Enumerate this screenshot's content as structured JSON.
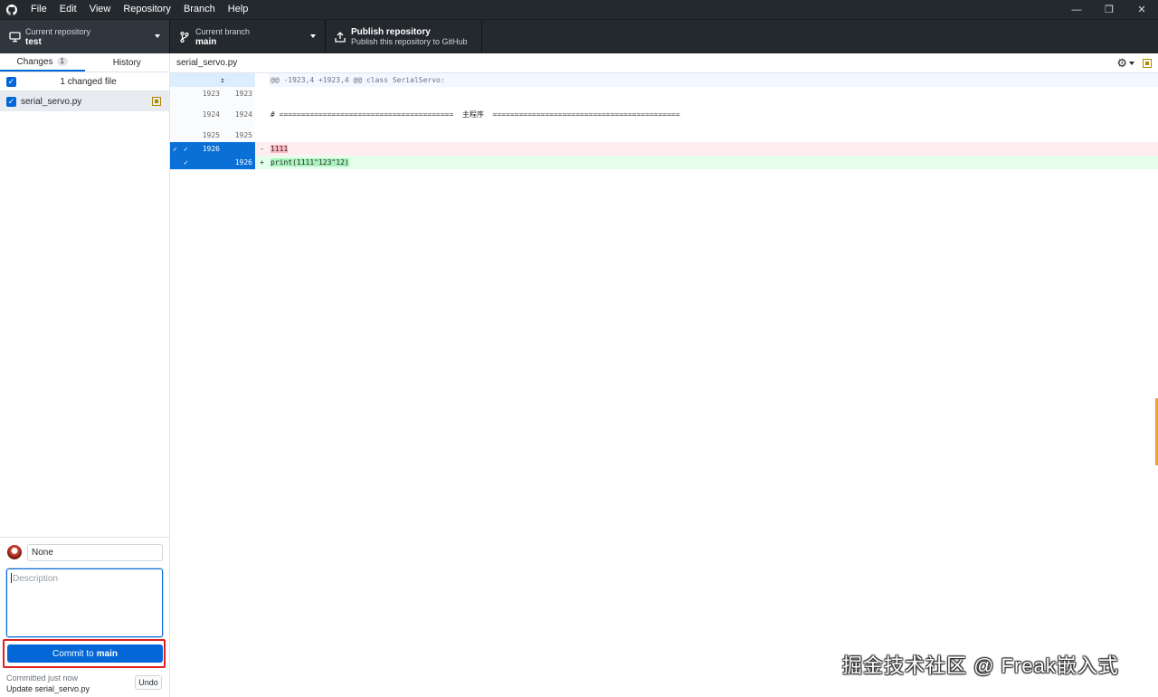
{
  "menu": [
    "File",
    "Edit",
    "View",
    "Repository",
    "Branch",
    "Help"
  ],
  "toolbar": {
    "repo": {
      "desc": "Current repository",
      "title": "test"
    },
    "branch": {
      "desc": "Current branch",
      "title": "main"
    },
    "publish": {
      "desc": "Publish this repository to GitHub",
      "title": "Publish repository"
    }
  },
  "sidebar": {
    "tabs": [
      {
        "label": "Changes",
        "count": "1"
      },
      {
        "label": "History"
      }
    ],
    "changed_files_label": "1 changed file",
    "files": [
      {
        "name": "serial_servo.py"
      }
    ]
  },
  "commit": {
    "summary_value": "None",
    "description_placeholder": "Description",
    "button_prefix": "Commit to",
    "button_branch": "main",
    "last_commit_time": "Committed just now",
    "last_commit_msg": "Update serial_servo.py",
    "undo_label": "Undo"
  },
  "diff": {
    "filename": "serial_servo.py",
    "hunk_header": "@@ -1923,4 +1923,4 @@ class SerialServo:",
    "lines": [
      {
        "old": "1923",
        "new": "1923",
        "code": ""
      },
      {
        "old": "1924",
        "new": "1924",
        "code": "# ========================================  主程序  ==========================================="
      },
      {
        "old": "1925",
        "new": "1925",
        "code": ""
      },
      {
        "old": "1926",
        "new": "",
        "mark": "-",
        "code": "1111"
      },
      {
        "old": "",
        "new": "1926",
        "mark": "+",
        "code": "print(1111\"123\"12)"
      }
    ]
  },
  "watermark": "掘金技术社区 @ Freak嵌入式",
  "colors": {
    "accent": "#0366d6",
    "titlebar": "#24292e",
    "deleted": "#ffeef0",
    "added": "#e6ffed",
    "highlight_box": "#e02020"
  }
}
